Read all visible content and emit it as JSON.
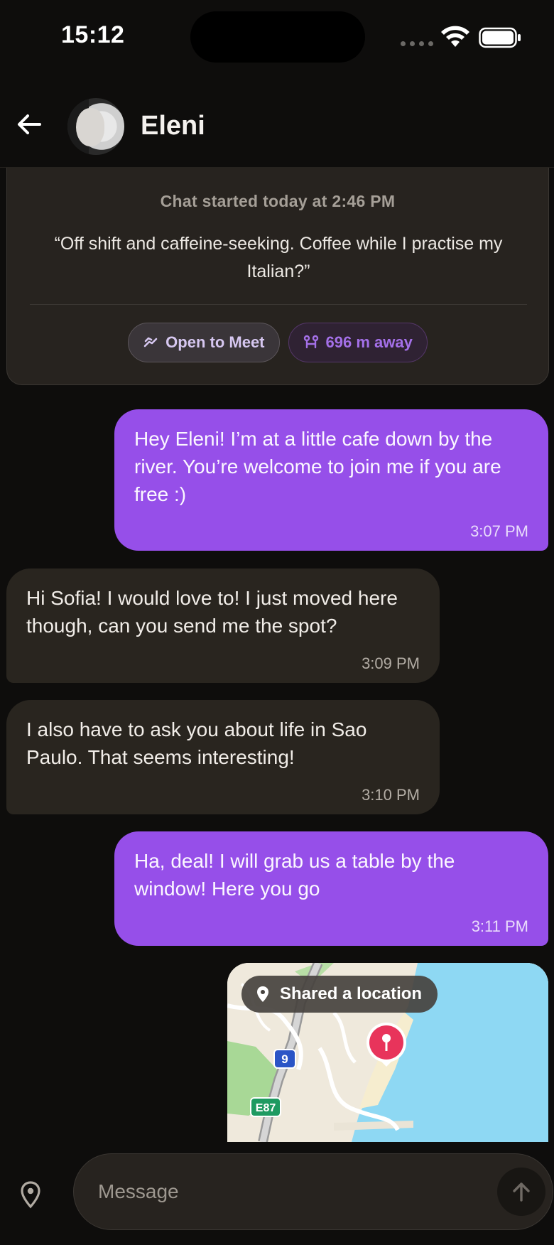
{
  "status_bar": {
    "time": "15:12"
  },
  "header": {
    "contact_name": "Eleni"
  },
  "intro": {
    "started": "Chat started today at 2:46 PM",
    "quote": "“Off shift and caffeine-seeking. Coffee while I practise my Italian?”",
    "chip_meet": "Open to Meet",
    "chip_distance": "696 m away"
  },
  "messages": [
    {
      "side": "sent",
      "text": "Hey Eleni! I’m at a little cafe down by the river. You’re welcome to join me if you are free :)",
      "time": "3:07 PM"
    },
    {
      "side": "received",
      "text": "Hi Sofia! I would love to! I just moved here though, can you send me the spot?",
      "time": "3:09 PM"
    },
    {
      "side": "received",
      "text": "I also have to ask you about life in Sao Paulo. That seems interesting!",
      "time": "3:10 PM"
    },
    {
      "side": "sent",
      "text": "Ha, deal! I will grab us a table by the window! Here you go",
      "time": "3:11 PM"
    }
  ],
  "location_share": {
    "label": "Shared a location",
    "road_badge_1": "9",
    "road_badge_2": "E87"
  },
  "composer": {
    "placeholder": "Message"
  },
  "colors": {
    "background": "#0e0d0c",
    "sent_bubble": "#964fe9",
    "received_bubble": "#29251f",
    "accent": "#a470e8"
  }
}
